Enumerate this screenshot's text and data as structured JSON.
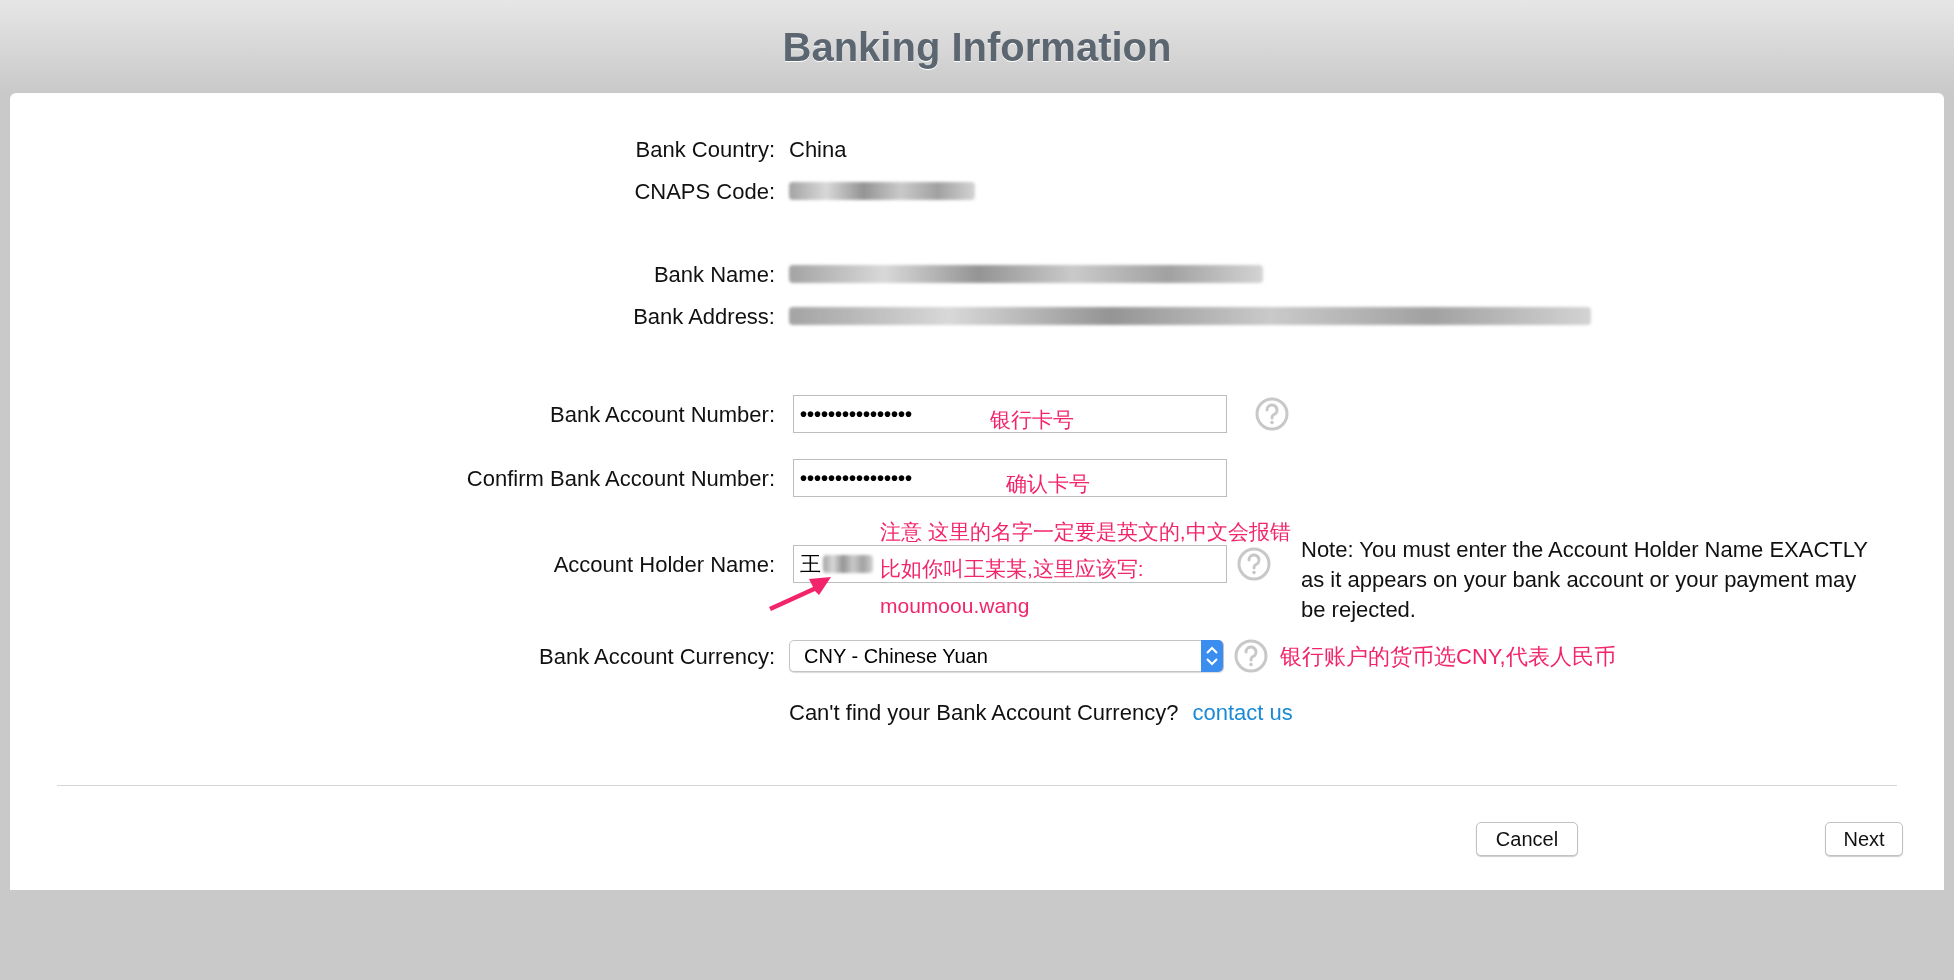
{
  "title": "Banking Information",
  "info_rows": [
    {
      "label": "Bank Country:",
      "value": "China",
      "redacted": false
    },
    {
      "label": "CNAPS Code:",
      "redacted": true
    },
    {
      "label": "Bank Name:",
      "redacted": true
    },
    {
      "label": "Bank Address:",
      "redacted": true
    }
  ],
  "account_number": {
    "label": "Bank Account Number:",
    "value": "••••••••••••••••",
    "help": true,
    "annotation": "银行卡号"
  },
  "confirm_number": {
    "label": "Confirm Bank Account Number:",
    "value": "••••••••••••••••",
    "help": false,
    "annotation": "确认卡号"
  },
  "holder_name": {
    "label": "Account Holder Name:",
    "value": "王",
    "redacted": true,
    "help": true,
    "annotations": [
      "注意 这里的名字一定要是英文的,中文会报错",
      "比如你叫王某某,这里应该写:",
      "moumoou.wang"
    ]
  },
  "note": "Note: You must enter the Account Holder Name EXACTLY as it appears on your bank account or your payment may be rejected.",
  "currency": {
    "label": "Bank Account Currency:",
    "value": "CNY - Chinese Yuan",
    "help": true,
    "annotation": "银行账户的货币选CNY,代表人民币"
  },
  "currency_hint": {
    "text": "Can't find your Bank Account Currency?",
    "link": "contact us"
  },
  "buttons": [
    {
      "label": "Cancel"
    },
    {
      "label": "Next"
    }
  ]
}
